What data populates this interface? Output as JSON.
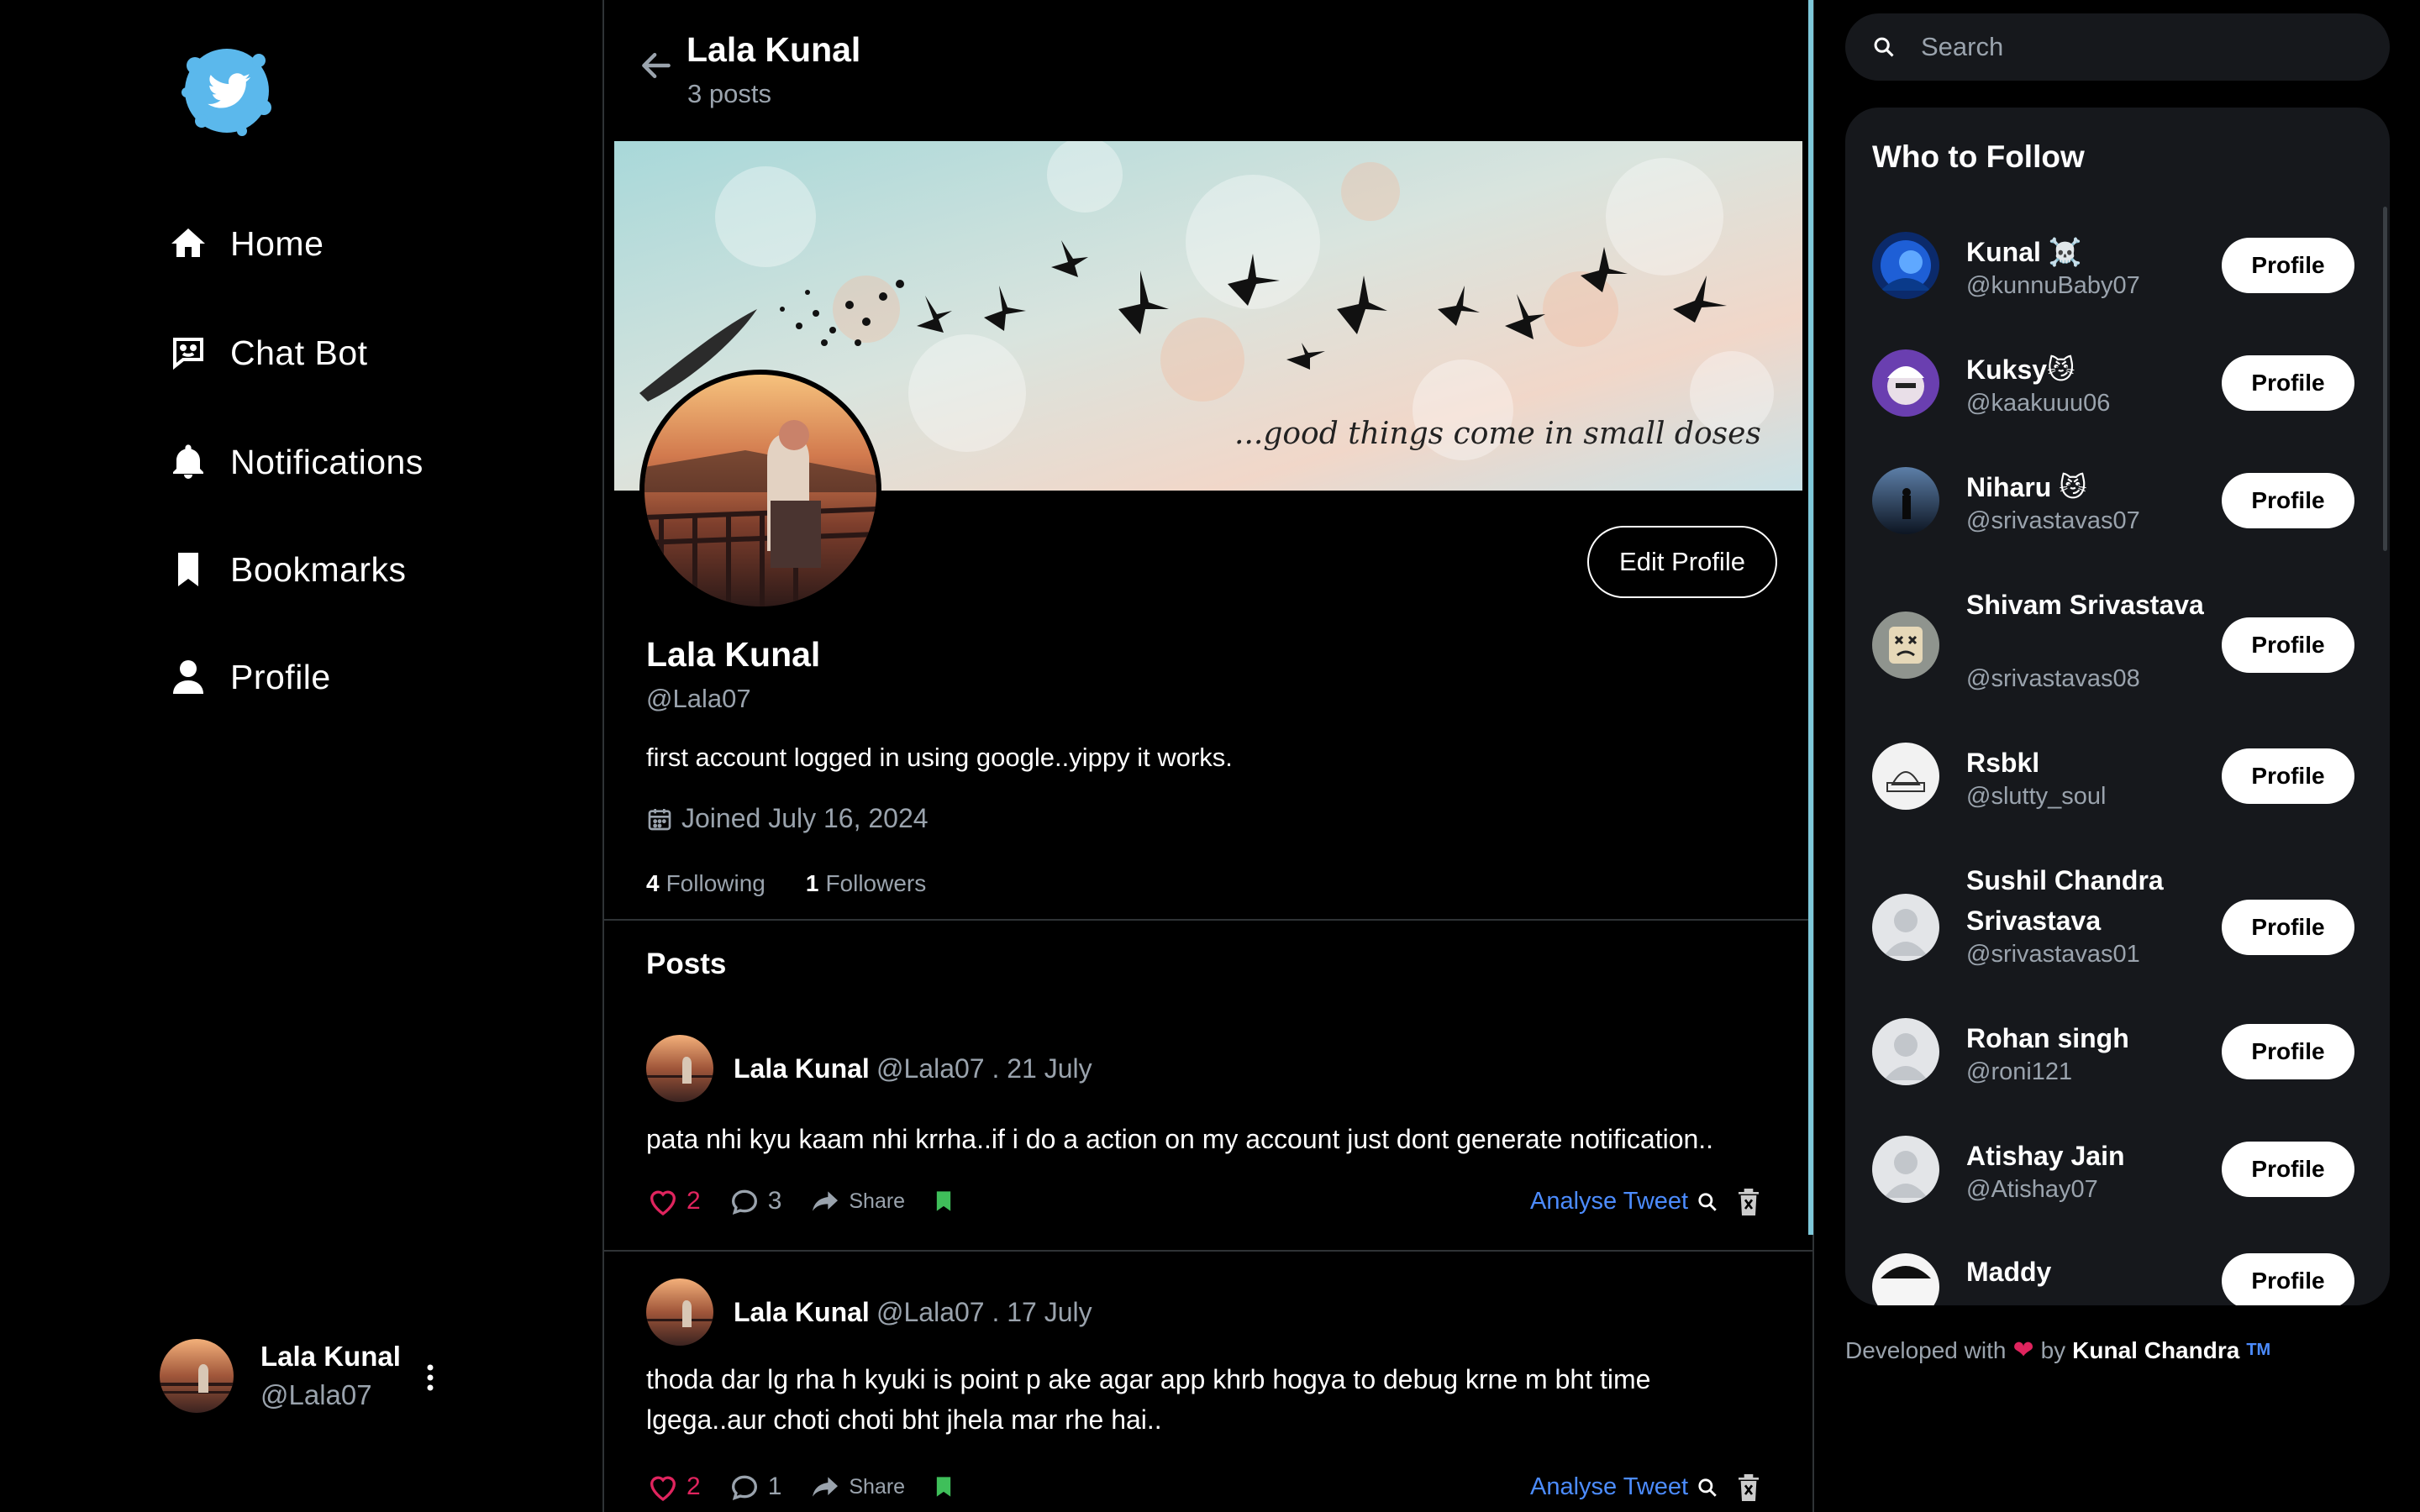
{
  "nav": {
    "items": [
      {
        "label": "Home",
        "icon": "home-icon"
      },
      {
        "label": "Chat Bot",
        "icon": "chat-bot-icon"
      },
      {
        "label": "Notifications",
        "icon": "bell-icon"
      },
      {
        "label": "Bookmarks",
        "icon": "bookmark-icon"
      },
      {
        "label": "Profile",
        "icon": "user-icon"
      }
    ]
  },
  "account": {
    "name": "Lala Kunal",
    "handle": "@Lala07"
  },
  "header": {
    "title": "Lala Kunal",
    "subtitle": "3 posts"
  },
  "banner": {
    "caption": "...good things come in small doses"
  },
  "profile": {
    "name": "Lala Kunal",
    "handle": "@Lala07",
    "bio": "first account logged in using google..yippy it works.",
    "joined": "Joined July 16, 2024",
    "following_count": "4",
    "following_label": "Following",
    "followers_count": "1",
    "followers_label": "Followers",
    "edit_label": "Edit Profile"
  },
  "posts_heading": "Posts",
  "posts": [
    {
      "name": "Lala Kunal",
      "meta": "@Lala07 . 21 July",
      "text": "pata nhi kyu kaam nhi krrha..if i do a action on my account just dont generate notification..",
      "likes": "2",
      "comments": "3",
      "share": "Share",
      "analyse": "Analyse Tweet"
    },
    {
      "name": "Lala Kunal",
      "meta": "@Lala07 . 17 July",
      "text": "thoda dar lg rha h kyuki is point p ake agar app khrb hogya to debug krne m bht time lgega..aur choti choti bht jhela mar rhe hai..",
      "likes": "2",
      "comments": "1",
      "share": "Share",
      "analyse": "Analyse Tweet"
    }
  ],
  "search": {
    "placeholder": "Search"
  },
  "who_to_follow": {
    "title": "Who to Follow",
    "button_label": "Profile",
    "users": [
      {
        "name": "Kunal ☠️",
        "handle": "@kunnuBaby07"
      },
      {
        "name": "Kuksy😼",
        "handle": "@kaakuuu06"
      },
      {
        "name": "Niharu 😼",
        "handle": "@srivastavas07"
      },
      {
        "name": "Shivam Srivastava",
        "handle": "@srivastavas08"
      },
      {
        "name": "Rsbkl",
        "handle": "@slutty_soul"
      },
      {
        "name": "Sushil Chandra Srivastava",
        "handle": "@srivastavas01"
      },
      {
        "name": "Rohan singh",
        "handle": "@roni121"
      },
      {
        "name": "Atishay Jain",
        "handle": "@Atishay07"
      },
      {
        "name": "Maddy",
        "handle": ""
      }
    ]
  },
  "footer": {
    "prefix": "Developed with",
    "by": "by",
    "author": "Kunal Chandra",
    "tm": "TM"
  },
  "colors": {
    "accent": "#1d9bf0",
    "like": "#e0245e",
    "link": "#4c8cff",
    "bookmark": "#3fbf5a",
    "panel": "#16181c"
  }
}
